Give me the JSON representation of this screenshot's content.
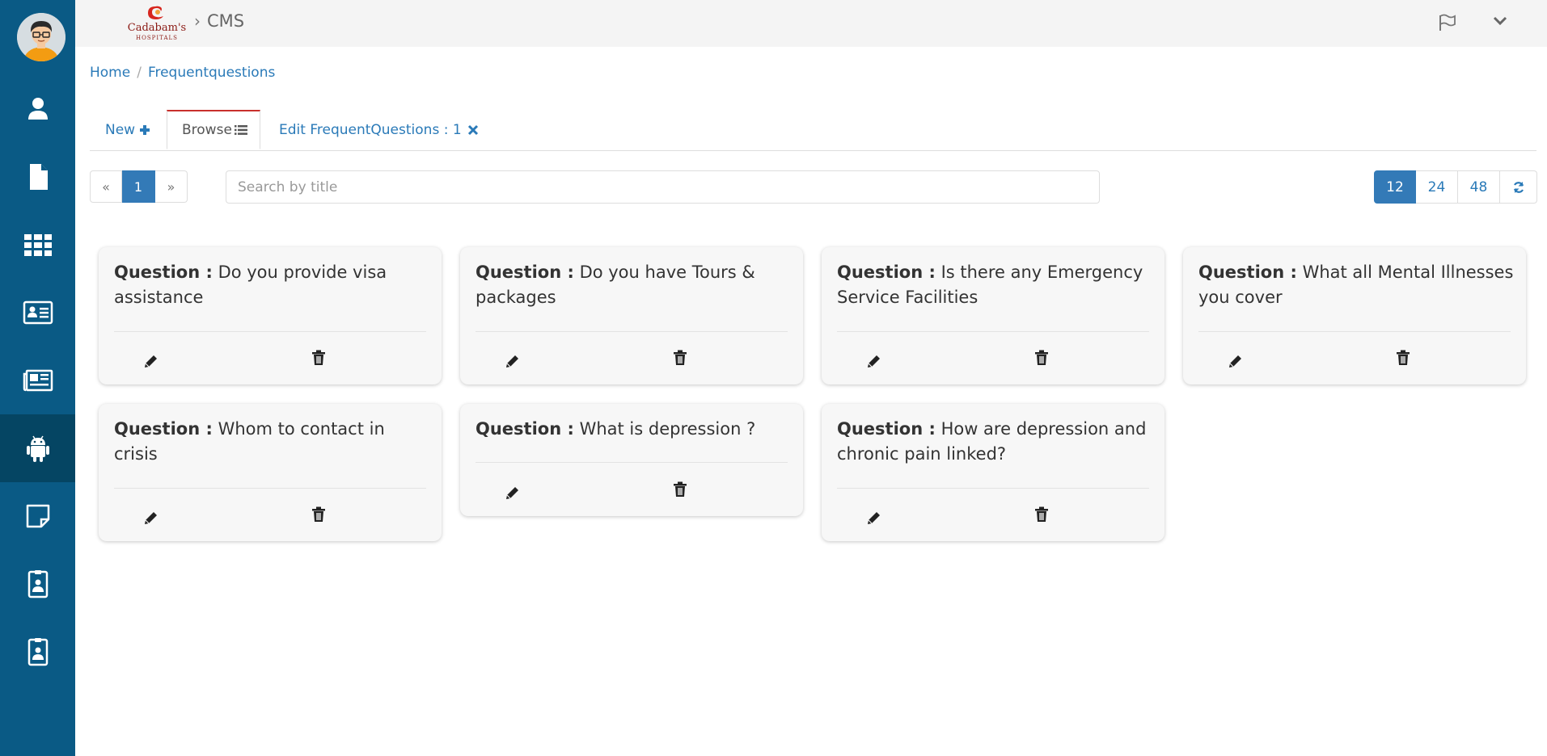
{
  "app": {
    "brand": {
      "name": "Cadabams",
      "sub": "HOSPITALS"
    },
    "section": "CMS"
  },
  "sidebar": {
    "items": [
      {
        "icon": "user-icon"
      },
      {
        "icon": "file-icon"
      },
      {
        "icon": "grid-icon"
      },
      {
        "icon": "id-card-icon"
      },
      {
        "icon": "newspaper-icon"
      },
      {
        "icon": "android-icon",
        "active": true
      },
      {
        "icon": "sticky-note-icon"
      },
      {
        "icon": "badge-icon"
      },
      {
        "icon": "badge-icon"
      }
    ]
  },
  "breadcrumb": {
    "home": "Home",
    "separator": "/",
    "current": "Frequentquestions"
  },
  "tabs": {
    "new": "New",
    "browse": "Browse",
    "edit": "Edit FrequentQuestions : 1"
  },
  "pagination": {
    "prev": "«",
    "current": "1",
    "next": "»"
  },
  "search": {
    "placeholder": "Search by title",
    "value": ""
  },
  "page_sizes": {
    "options": [
      "12",
      "24",
      "48"
    ],
    "selected": "12"
  },
  "cards": [
    {
      "label": "Question :",
      "text": "Do you provide visa assistance"
    },
    {
      "label": "Question :",
      "text": "Do you have Tours & packages"
    },
    {
      "label": "Question :",
      "text": "Is there any Emergency Service Facilities"
    },
    {
      "label": "Question :",
      "text": "What all Mental Illnesses you cover"
    },
    {
      "label": "Question :",
      "text": "Whom to contact in crisis"
    },
    {
      "label": "Question :",
      "text": "What is depression ?"
    },
    {
      "label": "Question :",
      "text": "How are depression and chronic pain linked?"
    }
  ],
  "colors": {
    "sidebar": "#0a5a85",
    "sidebar_active": "#054563",
    "accent": "#337ab7",
    "tab_active_border": "#c9302c"
  }
}
